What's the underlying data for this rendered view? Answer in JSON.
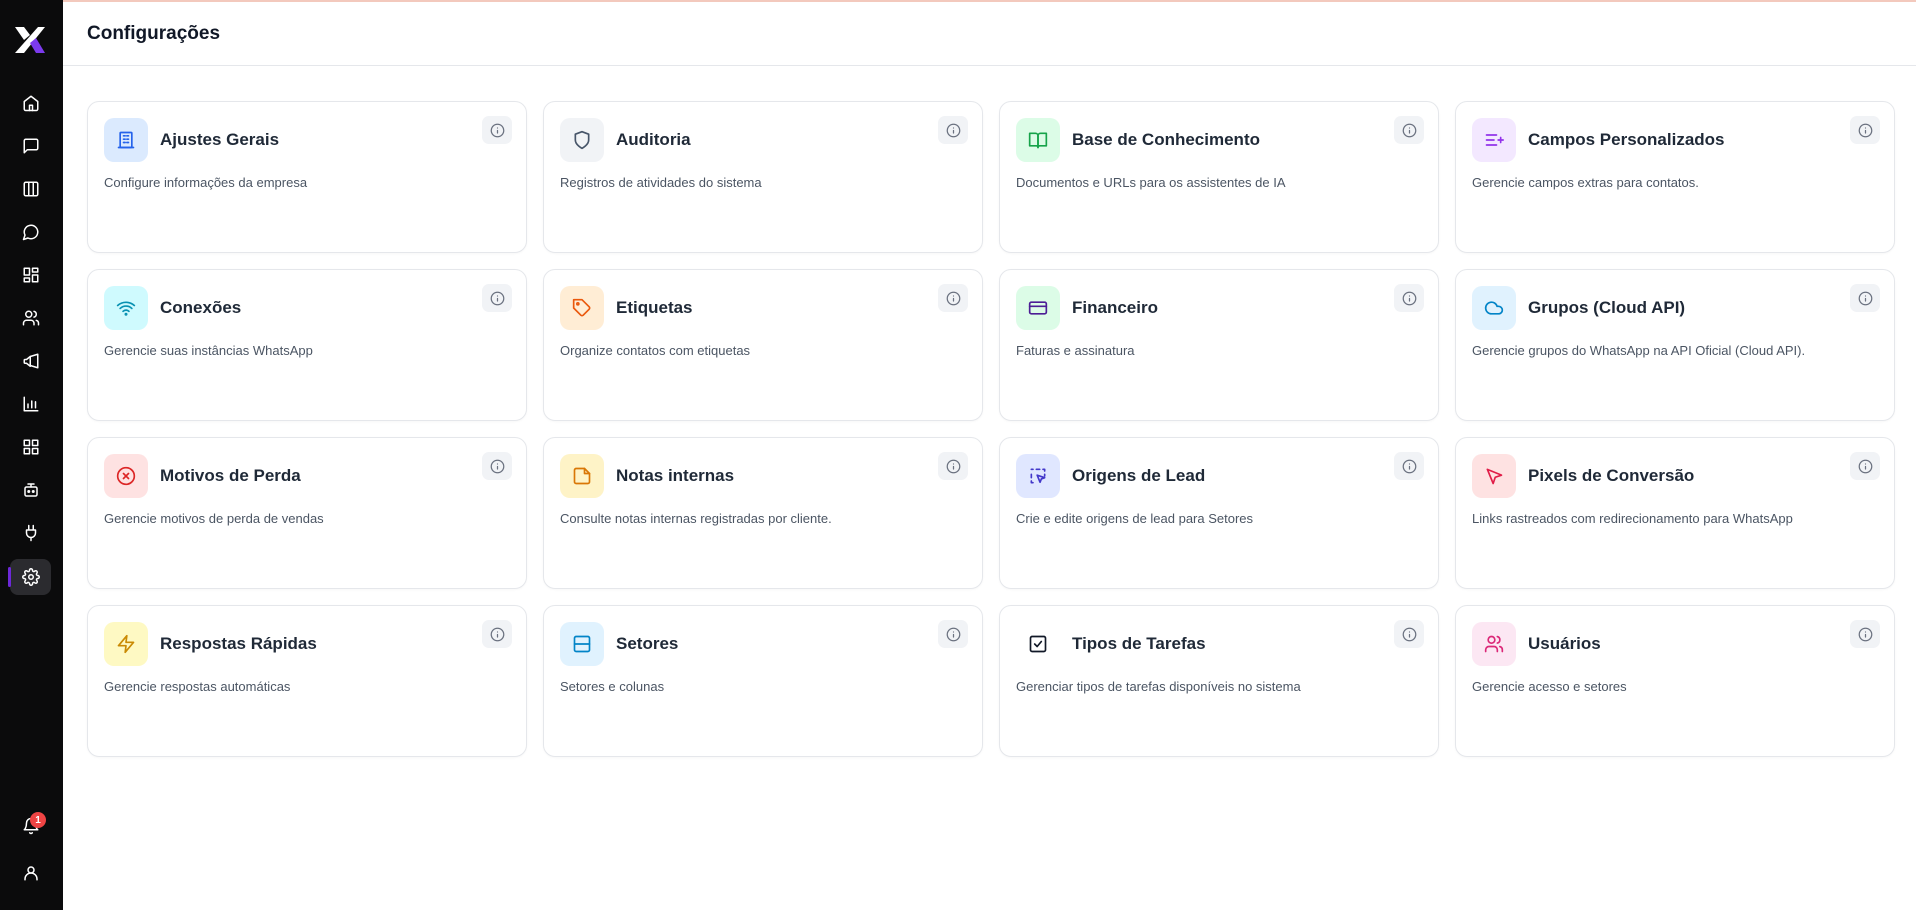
{
  "header": {
    "title": "Configurações"
  },
  "sidebar": {
    "notification_count": "1",
    "items": [
      {
        "name": "home-icon"
      },
      {
        "name": "message-square-icon"
      },
      {
        "name": "kanban-columns-icon"
      },
      {
        "name": "chat-bubble-icon"
      },
      {
        "name": "dashboard-icon"
      },
      {
        "name": "users-icon"
      },
      {
        "name": "megaphone-icon"
      },
      {
        "name": "bar-chart-icon"
      },
      {
        "name": "apps-grid-icon"
      },
      {
        "name": "bot-icon"
      },
      {
        "name": "plug-icon"
      },
      {
        "name": "gear-icon",
        "active": true
      }
    ],
    "accent": "#6d28d9"
  },
  "cards": [
    {
      "title": "Ajustes Gerais",
      "desc": "Configure informações da empresa",
      "icon": "building-icon",
      "bg": "#dbeafe",
      "color": "#2563eb"
    },
    {
      "title": "Auditoria",
      "desc": "Registros de atividades do sistema",
      "icon": "shield-icon",
      "bg": "#f1f3f6",
      "color": "#475569"
    },
    {
      "title": "Base de Conhecimento",
      "desc": "Documentos e URLs para os assistentes de IA",
      "icon": "book-open-icon",
      "bg": "#dcfce7",
      "color": "#16a34a"
    },
    {
      "title": "Campos Personalizados",
      "desc": "Gerencie campos extras para contatos.",
      "icon": "list-plus-icon",
      "bg": "#f3e8ff",
      "color": "#9333ea"
    },
    {
      "title": "Conexões",
      "desc": "Gerencie suas instâncias WhatsApp",
      "icon": "wifi-icon",
      "bg": "#cffafe",
      "color": "#0891b2"
    },
    {
      "title": "Etiquetas",
      "desc": "Organize contatos com etiquetas",
      "icon": "tag-icon",
      "bg": "#ffedd5",
      "color": "#ea580c"
    },
    {
      "title": "Financeiro",
      "desc": "Faturas e assinatura",
      "icon": "credit-card-icon",
      "bg": "#dcfce7",
      "color": "#4c1d95"
    },
    {
      "title": "Grupos (Cloud API)",
      "desc": "Gerencie grupos do WhatsApp na API Oficial (Cloud API).",
      "icon": "cloud-icon",
      "bg": "#e0f2fe",
      "color": "#0284c7"
    },
    {
      "title": "Motivos de Perda",
      "desc": "Gerencie motivos de perda de vendas",
      "icon": "x-circle-icon",
      "bg": "#fee2e2",
      "color": "#dc2626"
    },
    {
      "title": "Notas internas",
      "desc": "Consulte notas internas registradas por cliente.",
      "icon": "sticky-note-icon",
      "bg": "#fef3c7",
      "color": "#d97706"
    },
    {
      "title": "Origens de Lead",
      "desc": "Crie e edite origens de lead para Setores",
      "icon": "dashed-pointer-icon",
      "bg": "#e0e7ff",
      "color": "#4338ca"
    },
    {
      "title": "Pixels de Conversão",
      "desc": "Links rastreados com redirecionamento para WhatsApp",
      "icon": "cursor-click-icon",
      "bg": "#fee2e2",
      "color": "#e11d48"
    },
    {
      "title": "Respostas Rápidas",
      "desc": "Gerencie respostas automáticas",
      "icon": "zap-icon",
      "bg": "#fef9c3",
      "color": "#ca8a04"
    },
    {
      "title": "Setores",
      "desc": "Setores e colunas",
      "icon": "columns-icon",
      "bg": "#e0f2fe",
      "color": "#0284c7"
    },
    {
      "title": "Tipos de Tarefas",
      "desc": "Gerenciar tipos de tarefas disponíveis no sistema",
      "icon": "check-square-icon",
      "bg": "#ffffff",
      "color": "#111827"
    },
    {
      "title": "Usuários",
      "desc": "Gerencie acesso e setores",
      "icon": "users-icon",
      "bg": "#fce7f3",
      "color": "#db2777"
    }
  ]
}
